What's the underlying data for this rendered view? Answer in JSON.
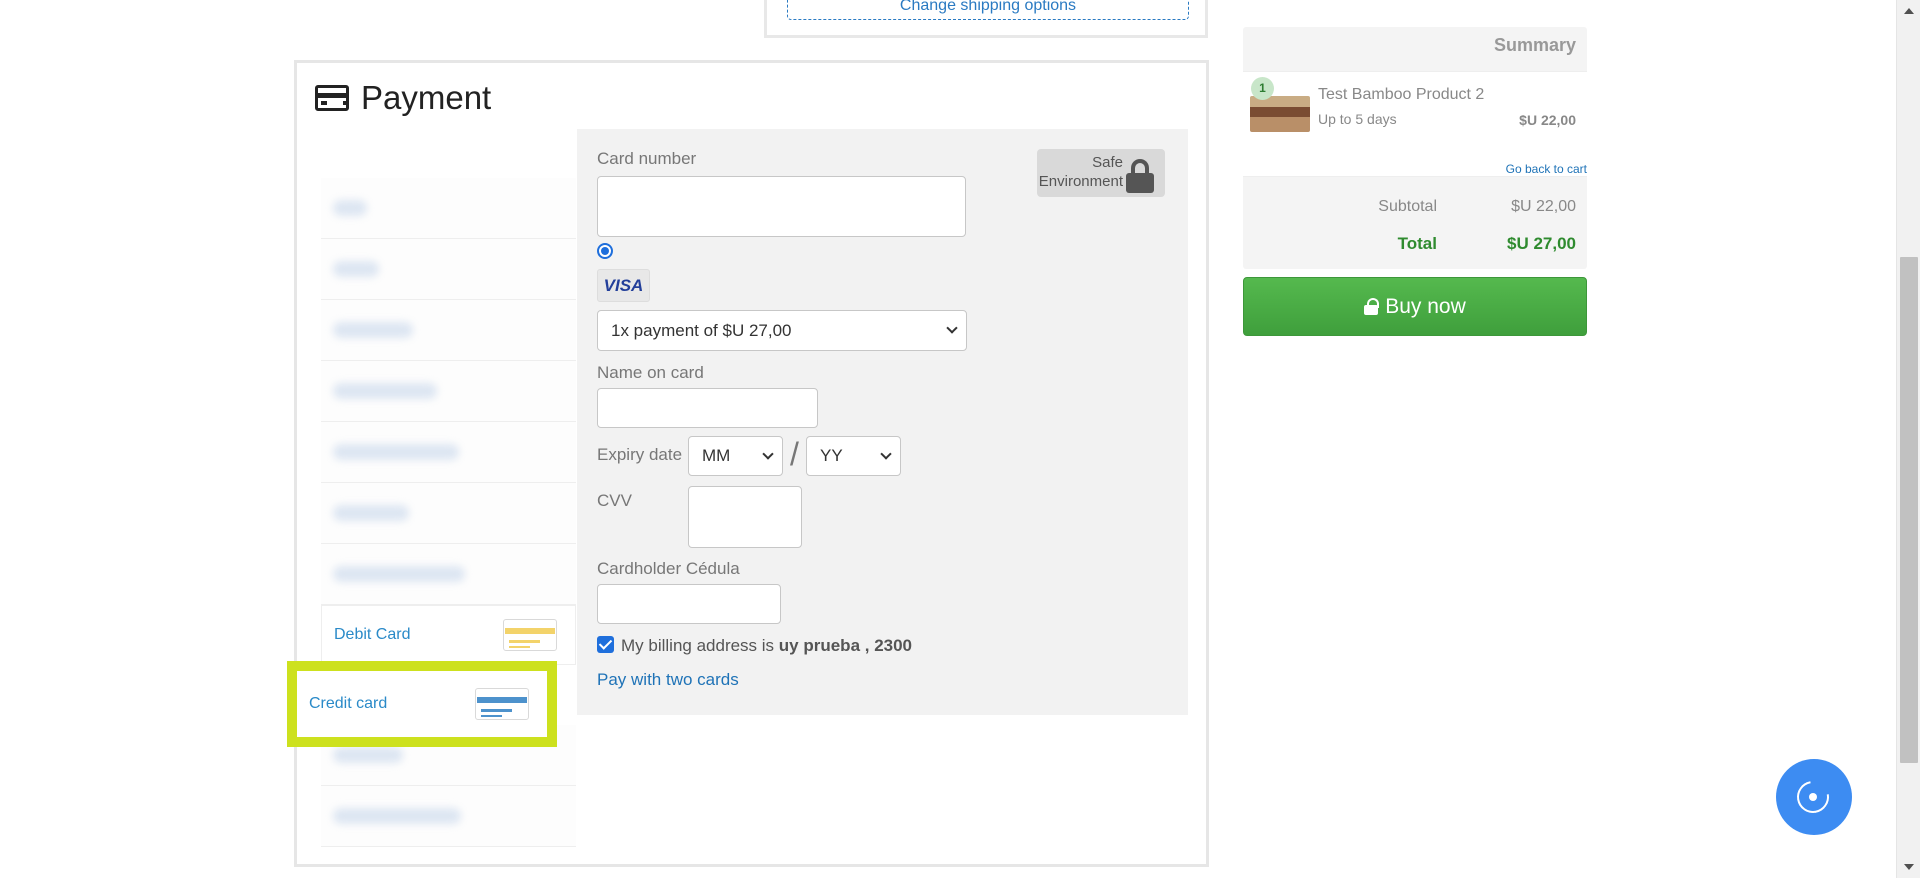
{
  "shipping": {
    "link_label": "Change shipping options"
  },
  "payment": {
    "title": "Payment",
    "methods": [
      {
        "label": "Debit Card",
        "selected": false,
        "card_color": "#f3d36a"
      },
      {
        "label": "Credit card",
        "selected": true,
        "card_color": "#4d92cc"
      }
    ],
    "highlight_color": "#cde11e",
    "form": {
      "card_number_label": "Card number",
      "card_number_value": "",
      "brand": "VISA",
      "installments_value": "1x payment of $U 27,00",
      "name_label": "Name on card",
      "name_value": "",
      "expiry_label": "Expiry date",
      "month_value": "MM",
      "year_value": "YY",
      "expiry_separator": "/",
      "cvv_label": "CVV",
      "cvv_value": "",
      "cedula_label": "Cardholder Cédula",
      "cedula_value": "",
      "billing_prefix": "My billing address is ",
      "billing_address": "uy prueba , 2300",
      "billing_checked": true,
      "two_cards_link": "Pay with two cards",
      "safe_line1": "Safe",
      "safe_line2": "Environment"
    }
  },
  "summary": {
    "title": "Summary",
    "item": {
      "quantity": "1",
      "name": "Test Bamboo Product 2",
      "delivery": "Up to 5 days",
      "price": "$U 22,00"
    },
    "back_to_cart": "Go back to cart",
    "subtotal_label": "Subtotal",
    "subtotal_value": "$U 22,00",
    "total_label": "Total",
    "total_value": "$U 27,00",
    "buy_button": "Buy now"
  },
  "icons": {
    "payment": "credit-card-icon",
    "security": "lock-icon",
    "chat": "chat-assistant-icon"
  },
  "colors": {
    "link_blue": "#1f73b7",
    "buy_green": "#45a744",
    "total_green": "#2f8b2f",
    "chat_blue": "#3d8cf2"
  }
}
